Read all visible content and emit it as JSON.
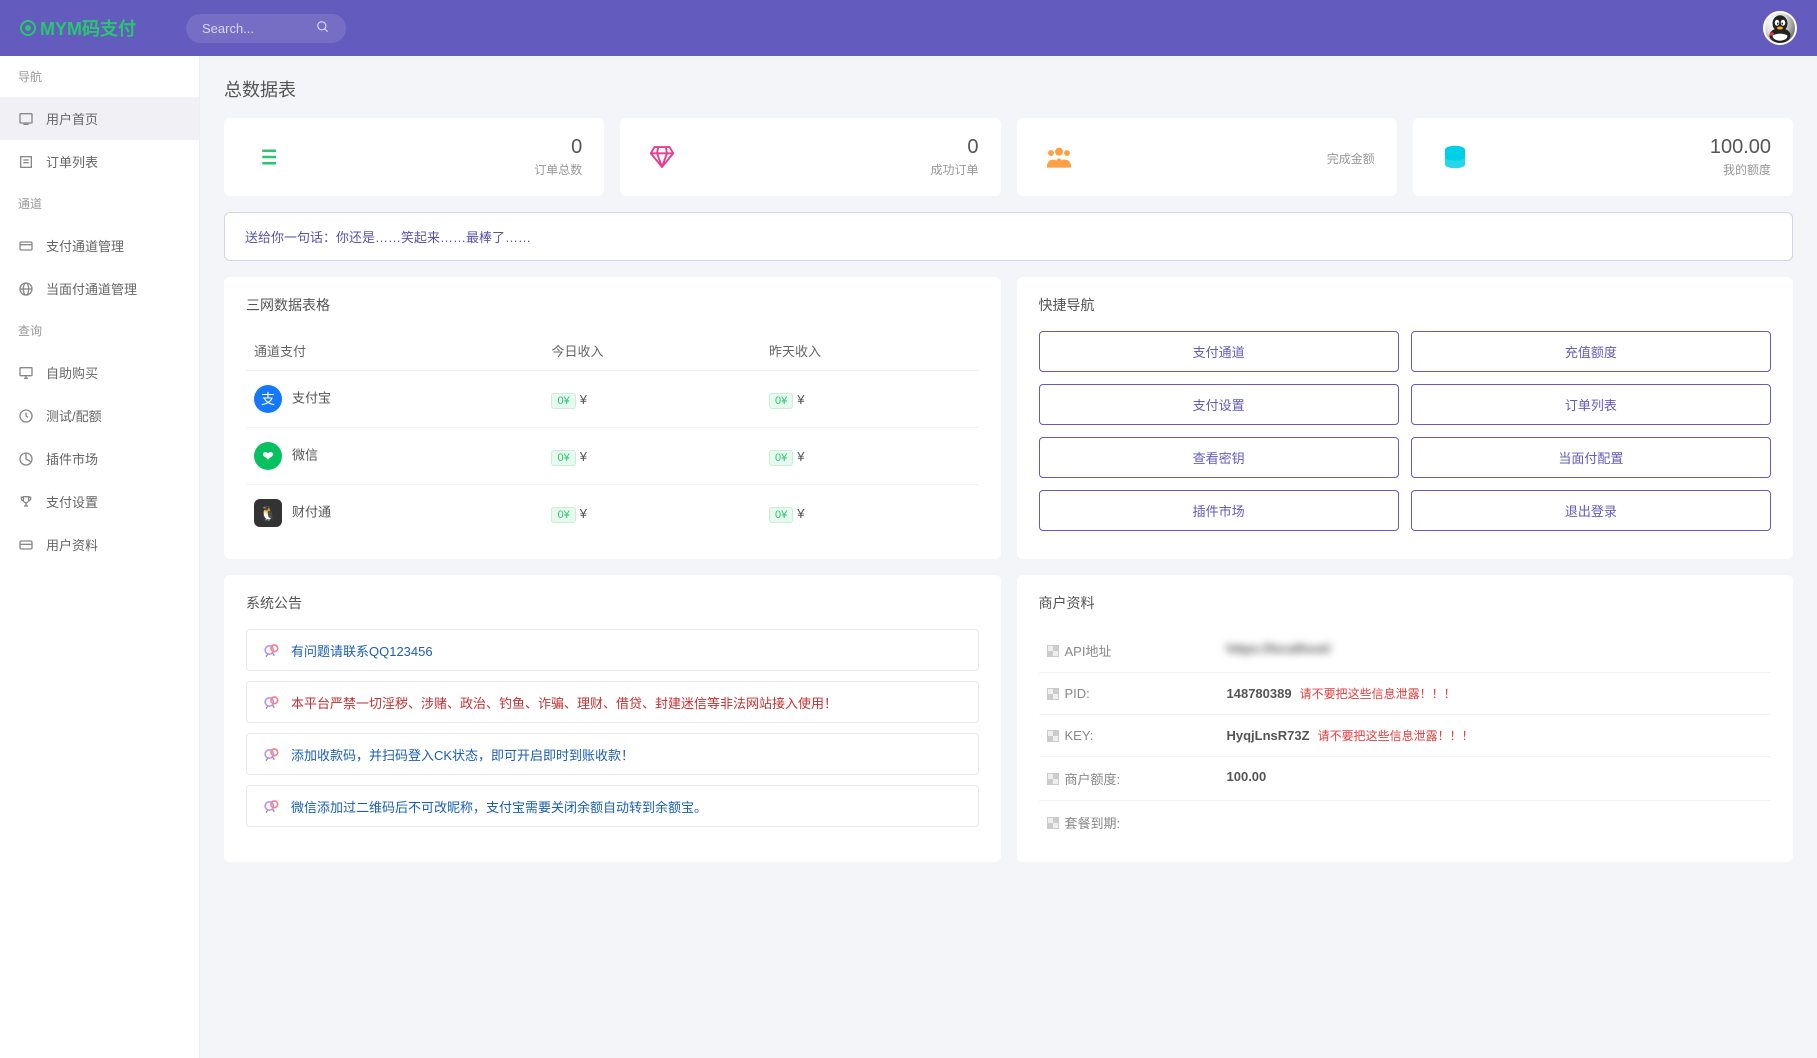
{
  "header": {
    "logo": "MYM码支付",
    "search_placeholder": "Search..."
  },
  "sidebar": {
    "groups": [
      {
        "label": "导航",
        "items": [
          {
            "label": "用户首页",
            "icon": "home",
            "active": true
          },
          {
            "label": "订单列表",
            "icon": "list"
          }
        ]
      },
      {
        "label": "通道",
        "items": [
          {
            "label": "支付通道管理",
            "icon": "card"
          },
          {
            "label": "当面付通道管理",
            "icon": "globe"
          }
        ]
      },
      {
        "label": "查询",
        "items": [
          {
            "label": "自助购买",
            "icon": "monitor"
          },
          {
            "label": "测试/配额",
            "icon": "clock"
          },
          {
            "label": "插件市场",
            "icon": "pie"
          },
          {
            "label": "支付设置",
            "icon": "trophy"
          },
          {
            "label": "用户资料",
            "icon": "idcard"
          }
        ]
      }
    ]
  },
  "page_title": "总数据表",
  "stats": [
    {
      "icon": "list",
      "color": "#28c76f",
      "value": "0",
      "label": "订单总数"
    },
    {
      "icon": "diamond",
      "color": "#e83e8c",
      "value": "0",
      "label": "成功订单"
    },
    {
      "icon": "users",
      "color": "#ff9f43",
      "value": "",
      "label": "完成金额"
    },
    {
      "icon": "db",
      "color": "#00cfe8",
      "value": "100.00",
      "label": "我的额度"
    }
  ],
  "quote": "送给你一句话：你还是……笑起来……最棒了……",
  "table": {
    "title": "三网数据表格",
    "headers": [
      "通道支付",
      "今日收入",
      "昨天收入"
    ],
    "rows": [
      {
        "name": "支付宝",
        "icon": "alipay",
        "today_badge": "0¥",
        "today": "¥",
        "yest_badge": "0¥",
        "yest": "¥"
      },
      {
        "name": "微信",
        "icon": "wechat",
        "today_badge": "0¥",
        "today": "¥",
        "yest_badge": "0¥",
        "yest": "¥"
      },
      {
        "name": "财付通",
        "icon": "qq",
        "today_badge": "0¥",
        "today": "¥",
        "yest_badge": "0¥",
        "yest": "¥"
      }
    ]
  },
  "quicknav": {
    "title": "快捷导航",
    "items": [
      "支付通道",
      "充值额度",
      "支付设置",
      "订单列表",
      "查看密钥",
      "当面付配置",
      "插件市场",
      "退出登录"
    ]
  },
  "notices": {
    "title": "系统公告",
    "items": [
      {
        "text": "有问题请联系QQ123456",
        "color": "blue"
      },
      {
        "text": "本平台严禁一切淫秽、涉赌、政治、钓鱼、诈骗、理财、借贷、封建迷信等非法网站接入使用！",
        "color": "red"
      },
      {
        "text": "添加收款码，并扫码登入CK状态，即可开启即时到账收款！",
        "color": "blue"
      },
      {
        "text": "微信添加过二维码后不可改昵称，支付宝需要关闭余额自动转到余额宝。",
        "color": "blue"
      }
    ]
  },
  "merchant": {
    "title": "商户资料",
    "rows": [
      {
        "label": "API地址",
        "value": "https://localhost/",
        "blur": true
      },
      {
        "label": "PID:",
        "value": "148780389",
        "warn": "请不要把这些信息泄露！！！"
      },
      {
        "label": "KEY:",
        "value": "HyqjLnsR73Z",
        "warn": "请不要把这些信息泄露！！！"
      },
      {
        "label": "商户额度:",
        "value": "100.00"
      },
      {
        "label": "套餐到期:",
        "value": ""
      }
    ]
  }
}
